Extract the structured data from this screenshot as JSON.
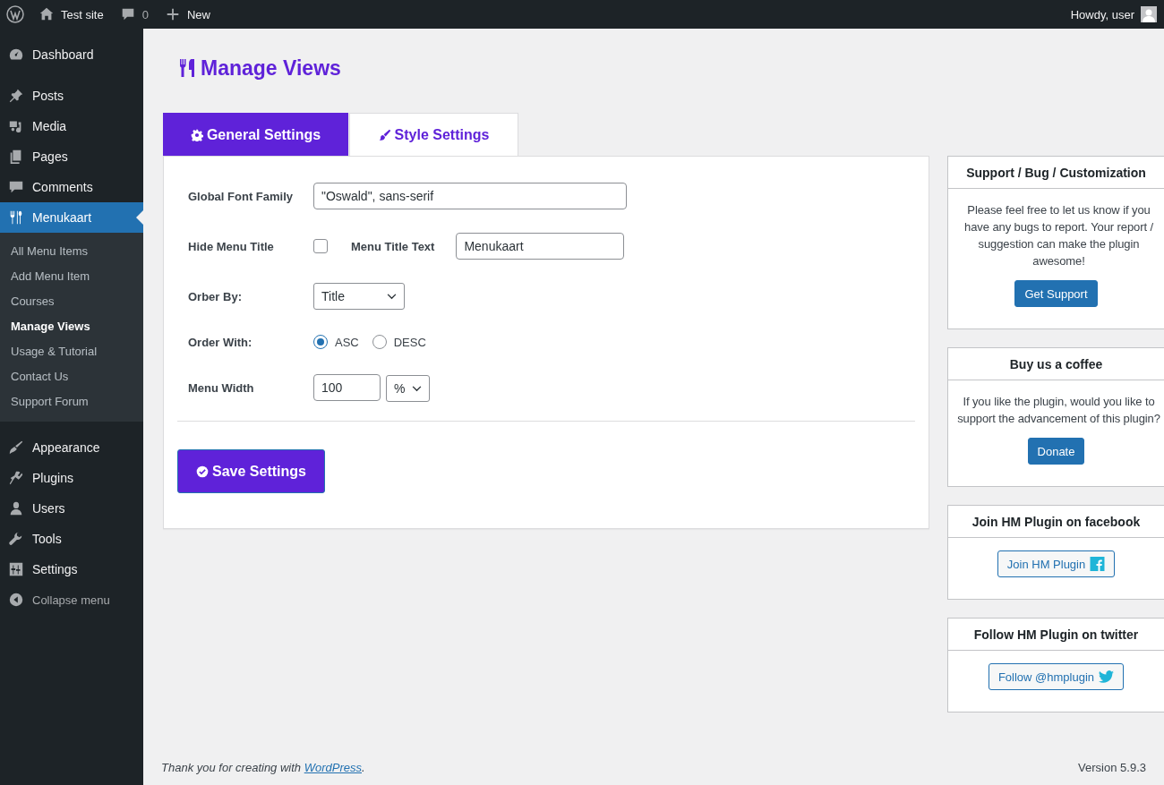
{
  "admin_bar": {
    "site_name": "Test site",
    "comments_count": "0",
    "new_label": "New",
    "greeting": "Howdy, user"
  },
  "sidebar": {
    "groups": [
      {
        "items": [
          {
            "label": "Dashboard",
            "selected": false
          }
        ]
      },
      {
        "items": [
          {
            "label": "Posts",
            "selected": false
          },
          {
            "label": "Media",
            "selected": false
          },
          {
            "label": "Pages",
            "selected": false
          },
          {
            "label": "Comments",
            "selected": false
          },
          {
            "label": "Menukaart",
            "selected": true,
            "children": [
              {
                "label": "All Menu Items",
                "selected": false
              },
              {
                "label": "Add Menu Item",
                "selected": false
              },
              {
                "label": "Courses",
                "selected": false
              },
              {
                "label": "Manage Views",
                "selected": true
              },
              {
                "label": "Usage & Tutorial",
                "selected": false
              },
              {
                "label": "Contact Us",
                "selected": false
              },
              {
                "label": "Support Forum",
                "selected": false
              }
            ]
          }
        ]
      },
      {
        "items": [
          {
            "label": "Appearance",
            "selected": false
          },
          {
            "label": "Plugins",
            "selected": false
          },
          {
            "label": "Users",
            "selected": false
          },
          {
            "label": "Tools",
            "selected": false
          },
          {
            "label": "Settings",
            "selected": false
          }
        ]
      }
    ],
    "collapse_label": "Collapse menu"
  },
  "page_title": "Manage Views",
  "tabs": [
    {
      "label": "General Settings",
      "selected": true
    },
    {
      "label": "Style Settings",
      "selected": false
    }
  ],
  "form": {
    "font_family": {
      "label": "Global Font Family",
      "value": "\"Oswald\", sans-serif"
    },
    "hide_title": {
      "label": "Hide Menu Title",
      "checked": false
    },
    "title_text": {
      "label": "Menu Title Text",
      "value": "Menukaart"
    },
    "order_by": {
      "label": "Orber By:",
      "value": "Title"
    },
    "order_with": {
      "label": "Order With:",
      "options": [
        {
          "label": "ASC",
          "selected": true
        },
        {
          "label": "DESC",
          "selected": false
        }
      ]
    },
    "menu_width": {
      "label": "Menu Width",
      "value": "100",
      "unit": "%"
    }
  },
  "save_button": "Save Settings",
  "widgets": [
    {
      "title": "Support / Bug / Customization",
      "text": "Please feel free to let us know if you have any bugs to report. Your report / suggestion can make the plugin awesome!",
      "button": "Get Support",
      "kind": "primary"
    },
    {
      "title": "Buy us a coffee",
      "text": "If you like the plugin, would you like to support the advancement of this plugin?",
      "button": "Donate",
      "kind": "primary"
    },
    {
      "title": "Join HM Plugin on facebook",
      "button": "Join HM Plugin",
      "kind": "facebook"
    },
    {
      "title": "Follow HM Plugin on twitter",
      "button": "Follow @hmplugin",
      "kind": "twitter"
    }
  ],
  "footer": {
    "text_before": "Thank you for creating with ",
    "link": "WordPress",
    "text_after": ".",
    "version": "Version 5.9.3"
  }
}
